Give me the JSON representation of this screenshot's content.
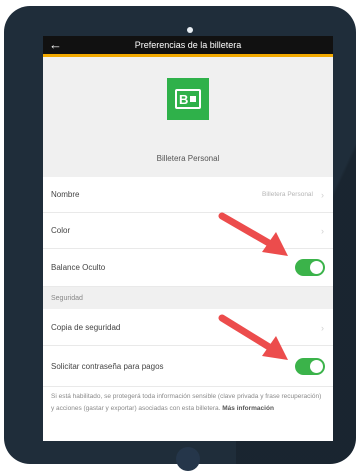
{
  "header": {
    "title": "Preferencias de la billetera",
    "back_icon": "←"
  },
  "wallet": {
    "icon_label": "B",
    "name": "Billetera Personal"
  },
  "settings": {
    "nombre_label": "Nombre",
    "nombre_value": "Billetera Personal",
    "color_label": "Color",
    "balance_label": "Balance Oculto",
    "balance_on": true
  },
  "security": {
    "section_label": "Seguridad",
    "backup_label": "Copia de seguridad",
    "password_label": "Solicitar contraseña para pagos",
    "password_on": true,
    "description": "Si está habilitado, se protegerá toda información sensible (clave privada y frase recuperación) y acciones (gastar y exportar) asociadas con esta billetera.",
    "more_info": "Más información"
  },
  "colors": {
    "accent": "#f2a900",
    "toggle": "#3bb34a",
    "wallet_icon": "#2fb14a",
    "arrow": "#ec4c4c"
  }
}
